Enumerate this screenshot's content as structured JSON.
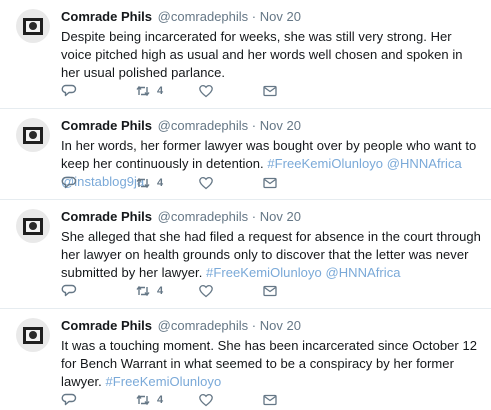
{
  "tweets": [
    {
      "name": "Comrade Phils",
      "handle": "@comradephils",
      "separator": "·",
      "date": "Nov 20",
      "segments": [
        {
          "text": "Despite being incarcerated for weeks, she was still very strong. Her voice pitched high as usual and her words well chosen and spoken in her usual polished parlance.",
          "tag": false
        }
      ],
      "retweets": "4"
    },
    {
      "name": "Comrade Phils",
      "handle": "@comradephils",
      "separator": "·",
      "date": "Nov 20",
      "segments": [
        {
          "text": "In her words, her former lawyer was bought over by people who want to keep her continuously in detention. ",
          "tag": false
        },
        {
          "text": "#FreeKemiOlunloyo @HNNAfrica @instablog9ja",
          "tag": true
        }
      ],
      "retweets": "4"
    },
    {
      "name": "Comrade Phils",
      "handle": "@comradephils",
      "separator": "·",
      "date": "Nov 20",
      "segments": [
        {
          "text": "She alleged that she had filed a request for absence in the court through her lawyer on health grounds only to discover that the letter was never submitted by her lawyer. ",
          "tag": false
        },
        {
          "text": "#FreeKemiOlunloyo @HNNAfrica",
          "tag": true
        }
      ],
      "retweets": "4"
    },
    {
      "name": "Comrade Phils",
      "handle": "@comradephils",
      "separator": "·",
      "date": "Nov 20",
      "segments": [
        {
          "text": "It was a touching moment. She has been incarcerated since October 12 for Bench Warrant in what seemed to be a conspiracy by her former lawyer. ",
          "tag": false
        },
        {
          "text": "#FreeKemiOlunloyo",
          "tag": true
        }
      ],
      "retweets": "4"
    }
  ],
  "icons": {
    "avatar": "profile-avatar",
    "reply": "reply-icon",
    "retweet": "retweet-icon",
    "like": "heart-icon",
    "message": "direct-message-icon"
  },
  "colors": {
    "hashtag": "#7aa9d8",
    "meta": "#657786",
    "icon": "#657786",
    "divider": "#e6ecf0"
  }
}
